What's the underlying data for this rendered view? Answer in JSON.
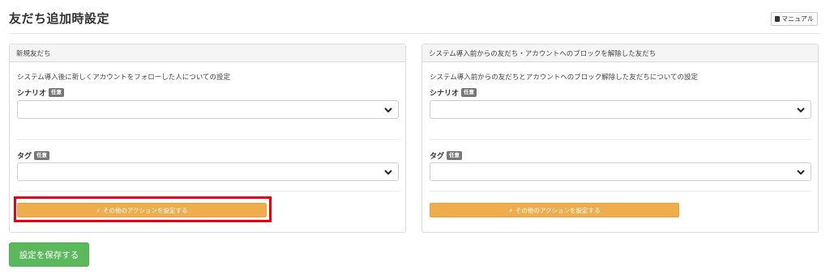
{
  "page": {
    "title": "友だち追加時設定",
    "manual_label": "マニュアル",
    "save_label": "設定を保存する"
  },
  "panels": [
    {
      "heading": "新規友だち",
      "description": "システム導入後に新しくアカウントをフォローした人についての設定",
      "scenario_label": "シナリオ",
      "scenario_badge": "任意",
      "scenario_value": "",
      "tag_label": "タグ",
      "tag_badge": "任意",
      "tag_value": "",
      "action_label": "その他のアクションを設定する",
      "highlighted": true
    },
    {
      "heading": "システム導入前からの友だち・アカウントへのブロックを解除した友だち",
      "description": "システム導入前からの友だちとアカウントへのブロック解除した友だちについての設定",
      "scenario_label": "シナリオ",
      "scenario_badge": "任意",
      "scenario_value": "",
      "tag_label": "タグ",
      "tag_badge": "任意",
      "tag_value": "",
      "action_label": "その他のアクションを設定する",
      "highlighted": false
    }
  ],
  "colors": {
    "action_button": "#f0ad4e",
    "save_button": "#5cb85c",
    "highlight_box": "#e60012",
    "badge": "#777777"
  },
  "icons": {
    "manual": "book-icon",
    "action": "bolt-icon",
    "select": "chevron-down-icon"
  }
}
